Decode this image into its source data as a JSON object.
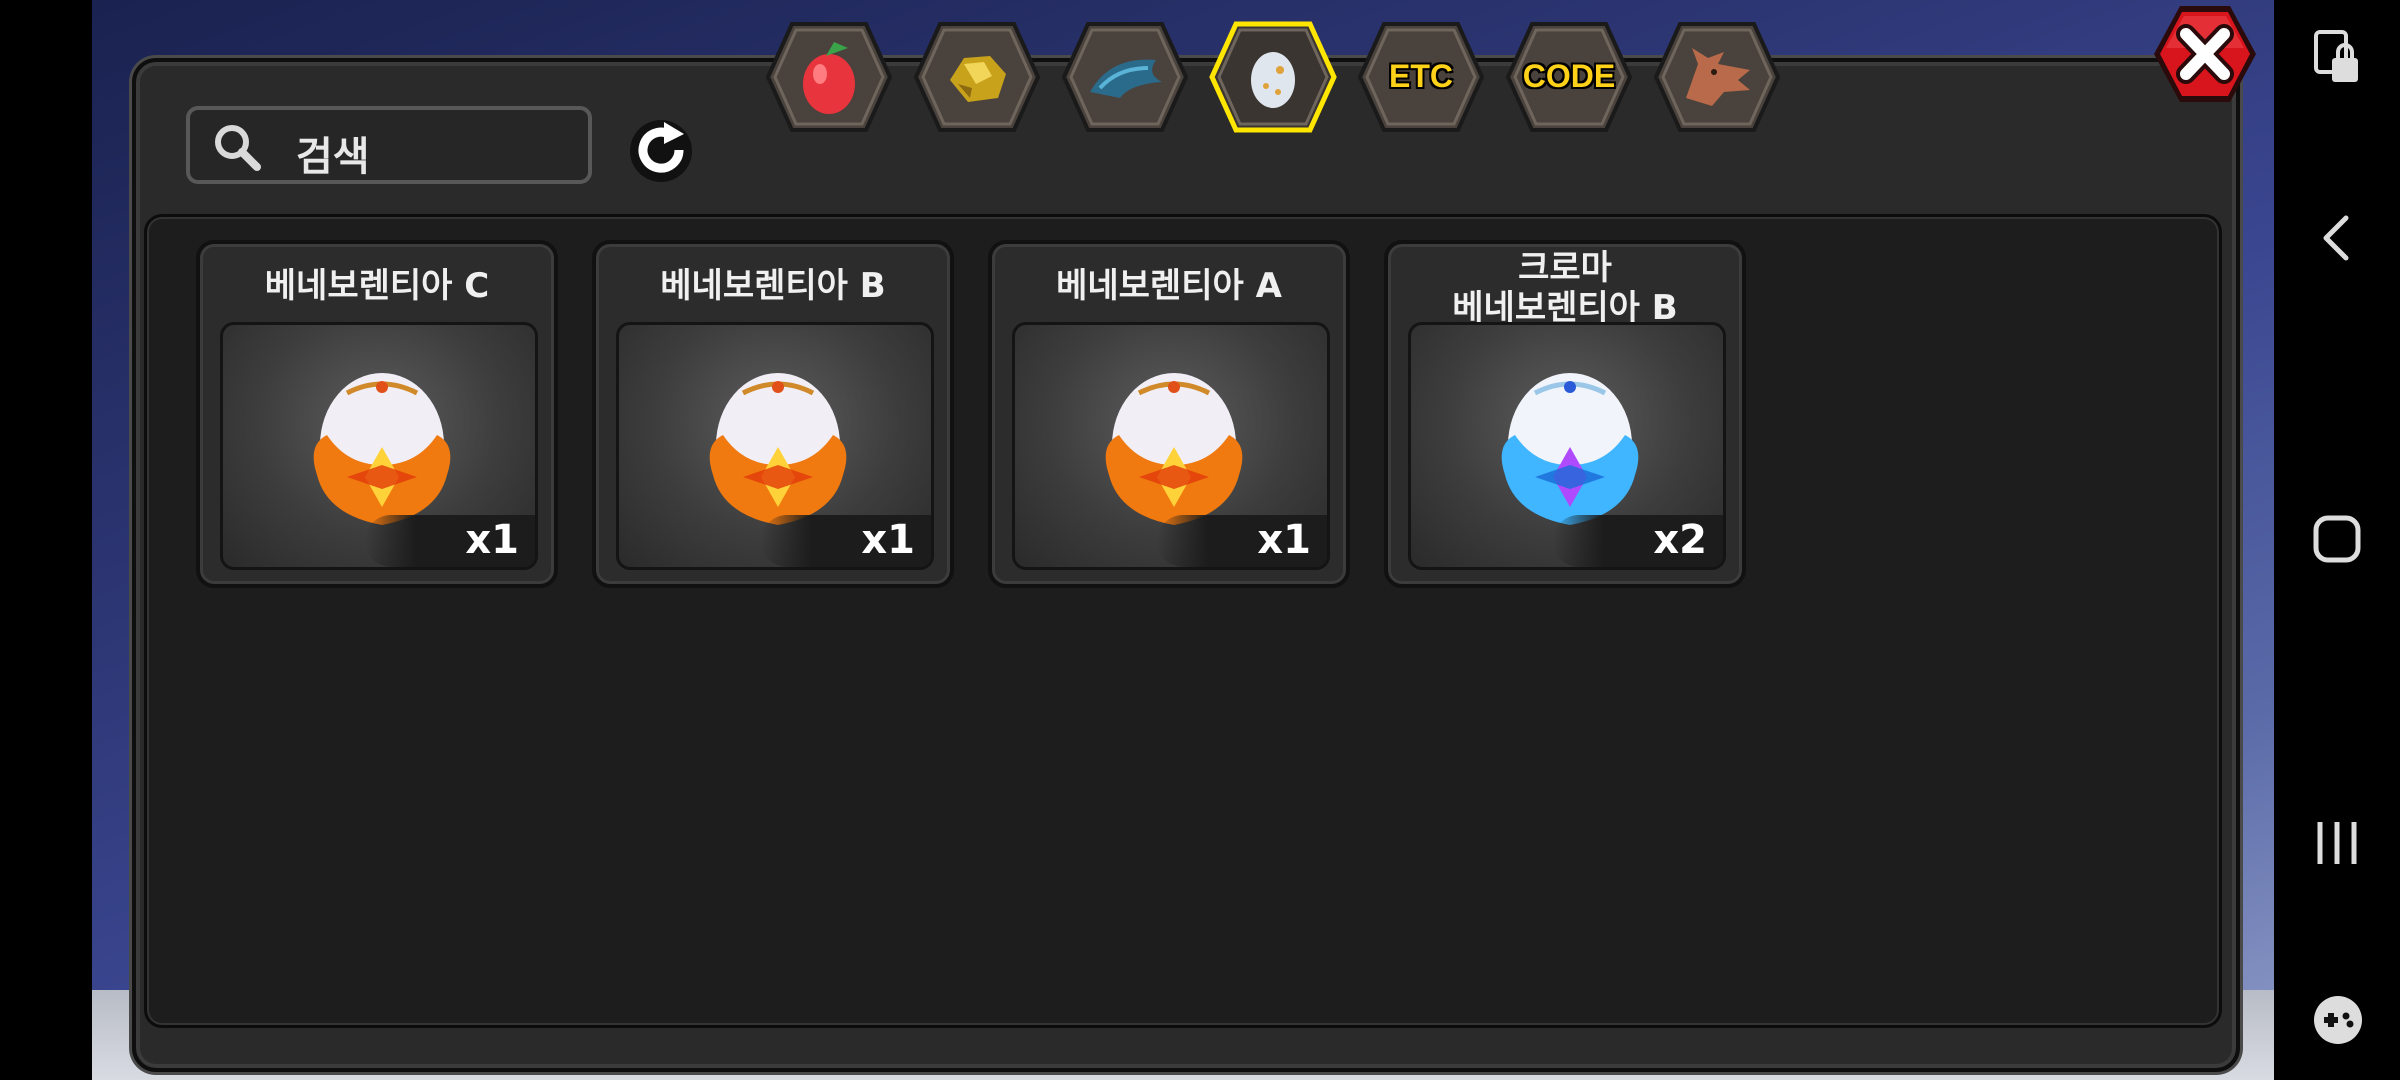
{
  "search": {
    "placeholder": "검색"
  },
  "tabs": [
    {
      "icon": "fruit-icon",
      "label": ""
    },
    {
      "icon": "gold-ore-icon",
      "label": ""
    },
    {
      "icon": "dragon-scale-icon",
      "label": ""
    },
    {
      "icon": "egg-icon",
      "label": "",
      "active": true
    },
    {
      "icon": "etc-icon",
      "label": "ETC"
    },
    {
      "icon": "code-icon",
      "label": "CODE"
    },
    {
      "icon": "dragon-head-icon",
      "label": ""
    }
  ],
  "items": [
    {
      "name": "베네보렌티아 C",
      "quantity": "x1",
      "egg_color": "#ff7a1a"
    },
    {
      "name": "베네보렌티아 B",
      "quantity": "x1",
      "egg_color": "#ff7a1a"
    },
    {
      "name": "베네보렌티아 A",
      "quantity": "x1",
      "egg_color": "#ff7a1a"
    },
    {
      "name_line1": "크로마",
      "name_line2": "베네보렌티아 B",
      "quantity": "x2",
      "egg_color": "#3fb6ff"
    }
  ],
  "colors": {
    "accent": "#ffd21a",
    "close": "#d8141c"
  }
}
